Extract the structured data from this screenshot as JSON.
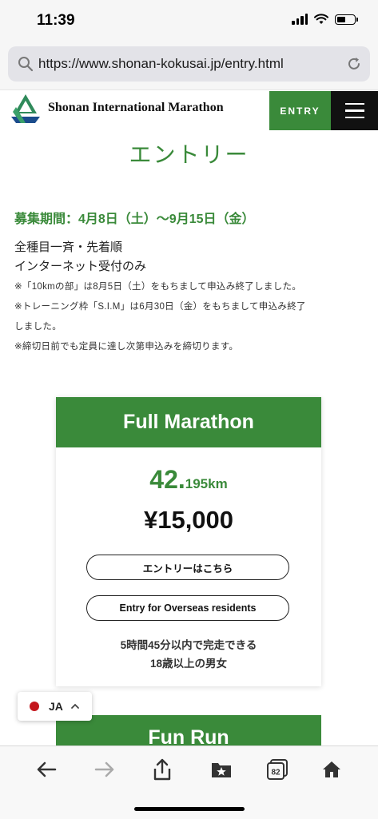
{
  "status_bar": {
    "time": "11:39"
  },
  "browser": {
    "url": "https://www.shonan-kokusai.jp/entry.html",
    "tabs_count": "82"
  },
  "site": {
    "logo_text": "Shonan International Marathon",
    "entry_label": "ENTRY",
    "brand_color": "#3a8a3a"
  },
  "content": {
    "title": "エントリー",
    "period": "募集期間：4月8日（土）〜9月15日（金）",
    "line1": "全種目一斉・先着順",
    "line2": "インターネット受付のみ",
    "notes": [
      "※「10kmの部」は8月5日（土）をもちまして申込み終了しました。",
      "※トレーニング枠「S.I.M」は6月30日（金）をもちまして申込み終了",
      "しました。",
      "※締切日前でも定員に達し次第申込みを締切ります。"
    ]
  },
  "cards": [
    {
      "title": "Full Marathon",
      "distance_big": "42.",
      "distance_small": "195km",
      "price": "¥15,000",
      "entry_button": "エントリーはこちら",
      "overseas_button": "Entry for Overseas residents",
      "condition_1": "5時間45分以内で完走できる",
      "condition_2": "18歳以上の男女"
    },
    {
      "title": "Fun Run"
    }
  ],
  "language": {
    "code": "JA"
  }
}
